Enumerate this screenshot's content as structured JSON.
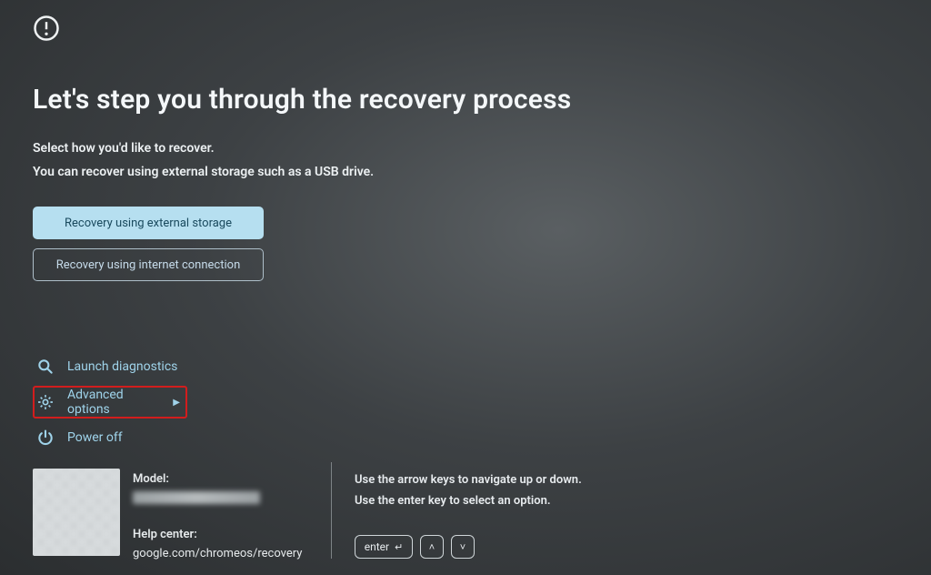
{
  "title": "Let's step you through the recovery process",
  "subtext1": "Select how you'd like to recover.",
  "subtext2": "You can recover using external storage such as a USB drive.",
  "options": {
    "external": "Recovery using external storage",
    "internet": "Recovery using internet connection"
  },
  "menu": {
    "diagnostics": "Launch diagnostics",
    "advanced": "Advanced options",
    "poweroff": "Power off"
  },
  "footer": {
    "model_label": "Model:",
    "help_label": "Help center:",
    "help_url": "google.com/chromeos/recovery"
  },
  "instructions": {
    "line1": "Use the arrow keys to navigate up or down.",
    "line2": "Use the enter key to select an option.",
    "enter_label": "enter"
  }
}
